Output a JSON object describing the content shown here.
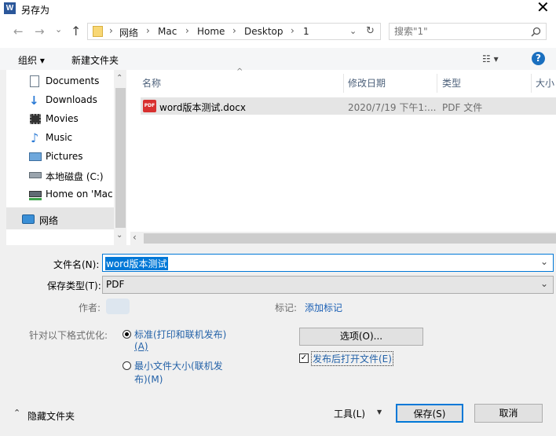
{
  "window": {
    "title": "另存为",
    "app_icon": "W",
    "close": "✕"
  },
  "nav": {
    "back": "←",
    "forward": "→",
    "dropdown": "⌄",
    "up": "↑"
  },
  "address": {
    "breadcrumbs": [
      "网络",
      "Mac",
      "Home",
      "Desktop",
      "1"
    ],
    "separator": "›",
    "dropdown": "⌄",
    "refresh": "↻"
  },
  "search": {
    "placeholder": "搜索\"1\"",
    "icon": "search-icon"
  },
  "toolbar": {
    "organize": "组织 ▾",
    "new_folder": "新建文件夹",
    "view": "☷ ▾",
    "help": "?"
  },
  "sidebar": {
    "scroll_up": "⌃",
    "scroll_down": "⌄",
    "items": [
      {
        "label": "Documents",
        "icon": "documents-icon"
      },
      {
        "label": "Downloads",
        "icon": "downloads-icon"
      },
      {
        "label": "Movies",
        "icon": "movies-icon"
      },
      {
        "label": "Music",
        "icon": "music-icon"
      },
      {
        "label": "Pictures",
        "icon": "pictures-icon"
      },
      {
        "label": "本地磁盘 (C:)",
        "icon": "drive-icon"
      },
      {
        "label": "Home on 'Mac",
        "icon": "network-drive-icon"
      },
      {
        "label": "网络",
        "icon": "network-icon"
      }
    ]
  },
  "file_list": {
    "columns": [
      "名称",
      "修改日期",
      "类型",
      "大小"
    ],
    "sort_arrow": "^",
    "rows": [
      {
        "name": "word版本测试.docx",
        "modified": "2020/7/19 下午1:...",
        "type": "PDF 文件",
        "icon_text": "PDF"
      }
    ],
    "scroll_left": "‹",
    "scroll_right": "›"
  },
  "form": {
    "filename_label": "文件名(N):",
    "filename_value": "word版本测试",
    "filetype_label": "保存类型(T):",
    "filetype_value": "PDF",
    "author_label": "作者:",
    "tags_label": "标记:",
    "tags_link": "添加标记",
    "optimize_label": "针对以下格式优化:",
    "option_standard_1": "标准(打印和联机发布)",
    "option_standard_2": "(A)",
    "option_min_1": "最小文件大小(联机发",
    "option_min_2": "布)(M)",
    "options_button": "选项(O)...",
    "open_after": "发布后打开文件(E)",
    "check_mark": "✓",
    "dropdown": "⌄"
  },
  "footer": {
    "hide_folders": "隐藏文件夹",
    "hide_arrow": "⌃",
    "tools": "工具(L)",
    "tools_arrow": "▼",
    "save": "保存(S)",
    "cancel": "取消"
  },
  "colors": {
    "accent": "#1a6fbf",
    "selection": "#0078d7",
    "link": "#1a5fb4"
  }
}
